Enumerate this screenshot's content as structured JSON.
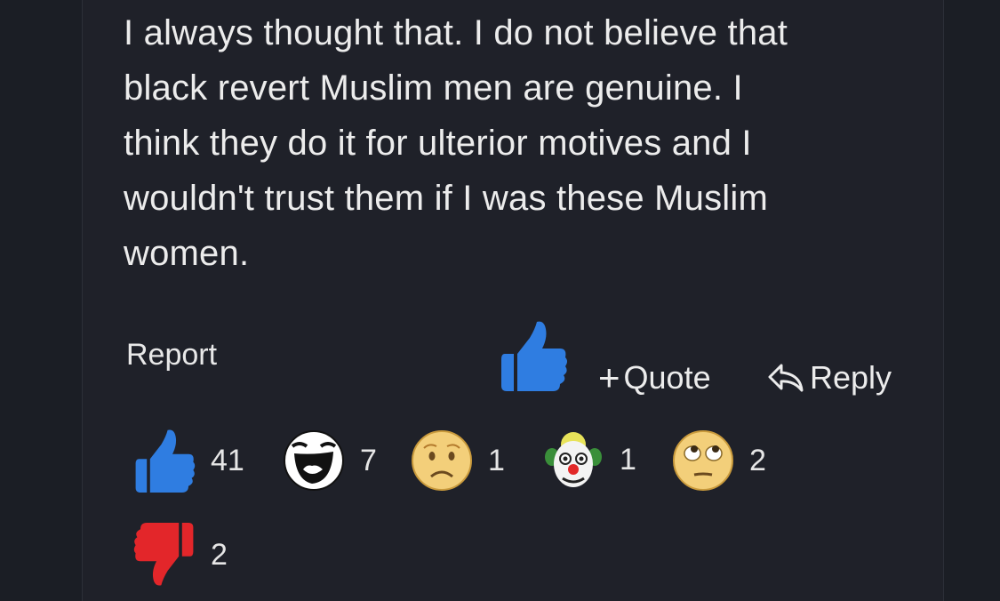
{
  "post": {
    "body_lines": [
      "I always thought that. I do not believe that",
      "black revert Muslim men are genuine. I",
      "think they do it for ulterior motives and I",
      "wouldn't trust them if I was these Muslim",
      "women."
    ]
  },
  "actions": {
    "report_label": "Report",
    "quote_plus": "+",
    "quote_label": "Quote",
    "reply_label": "Reply"
  },
  "reactions": [
    {
      "icon": "thumbs-up-icon",
      "count": "41"
    },
    {
      "icon": "laughing-face-icon",
      "count": "7"
    },
    {
      "icon": "sad-face-icon",
      "count": "1"
    },
    {
      "icon": "clown-face-icon",
      "count": "1"
    },
    {
      "icon": "eye-roll-face-icon",
      "count": "2"
    },
    {
      "icon": "thumbs-down-icon",
      "count": "2"
    }
  ],
  "colors": {
    "background": "#1b1e25",
    "post_background": "#1f2129",
    "like_blue": "#2f7de1",
    "dislike_red": "#e3262a",
    "emoji_yellow": "#f3cf7a"
  }
}
